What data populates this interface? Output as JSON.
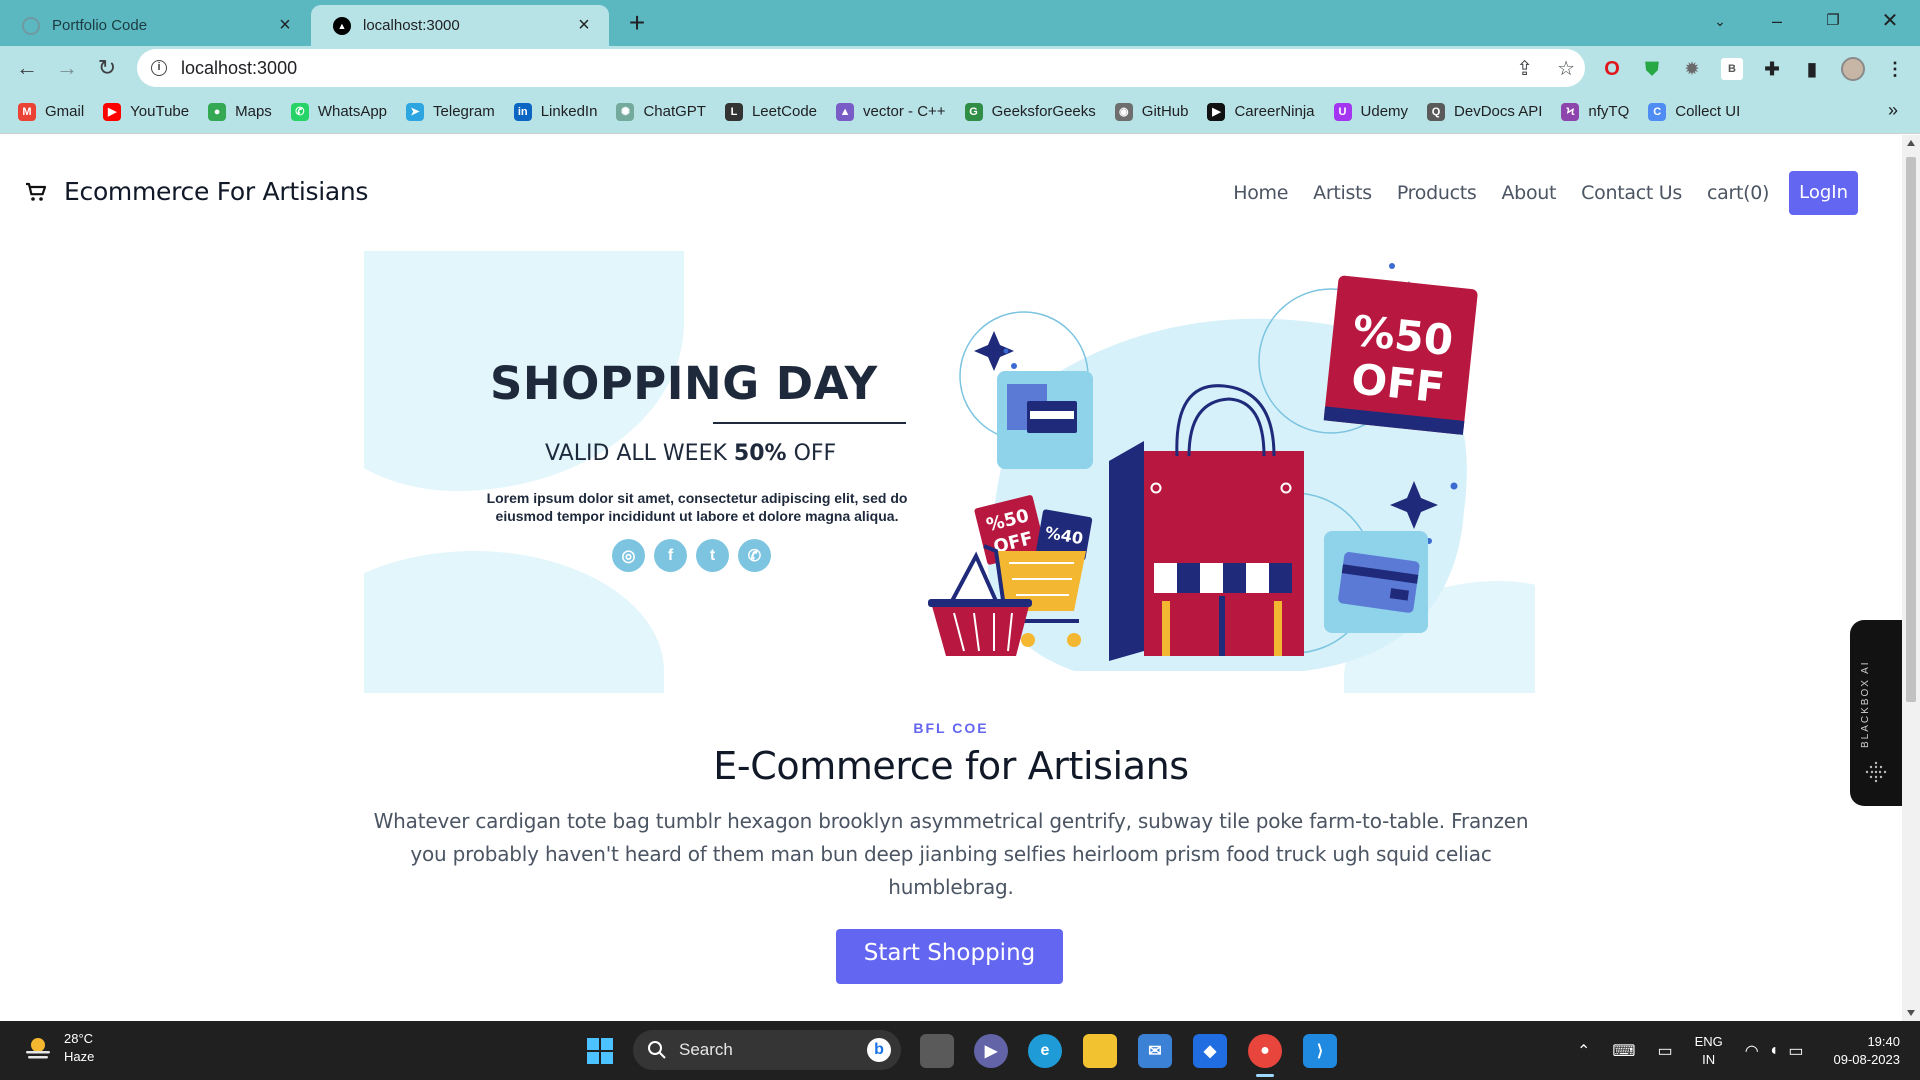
{
  "browser": {
    "tabs": [
      {
        "title": "Portfolio Code",
        "active": false
      },
      {
        "title": "localhost:3000",
        "active": true
      }
    ],
    "url": "localhost:3000",
    "bookmarks": [
      {
        "label": "Gmail",
        "icon": "gmail-icon",
        "color": "#ea4335"
      },
      {
        "label": "YouTube",
        "icon": "youtube-icon",
        "color": "#ff0000"
      },
      {
        "label": "Maps",
        "icon": "maps-icon",
        "color": "#34a853"
      },
      {
        "label": "WhatsApp",
        "icon": "whatsapp-icon",
        "color": "#25d366"
      },
      {
        "label": "Telegram",
        "icon": "telegram-icon",
        "color": "#2ca5e0"
      },
      {
        "label": "LinkedIn",
        "icon": "linkedin-icon",
        "color": "#0a66c2"
      },
      {
        "label": "ChatGPT",
        "icon": "chatgpt-icon",
        "color": "#74aa9c"
      },
      {
        "label": "LeetCode",
        "icon": "leetcode-icon",
        "color": "#333333"
      },
      {
        "label": "vector - C++",
        "icon": "cplusplus-icon",
        "color": "#7a5cc7"
      },
      {
        "label": "GeeksforGeeks",
        "icon": "geeksforgeeks-icon",
        "color": "#2f8d46"
      },
      {
        "label": "GitHub",
        "icon": "github-icon",
        "color": "#6e6e6e"
      },
      {
        "label": "CareerNinja",
        "icon": "careerninja-icon",
        "color": "#111111"
      },
      {
        "label": "Udemy",
        "icon": "udemy-icon",
        "color": "#a435f0"
      },
      {
        "label": "DevDocs API",
        "icon": "devdocs-icon",
        "color": "#5a5a5a"
      },
      {
        "label": "nfyTQ",
        "icon": "nfytq-icon",
        "color": "#8e44ad"
      },
      {
        "label": "Collect UI",
        "icon": "collectui-icon",
        "color": "#4f8df5"
      }
    ],
    "more_bookmarks": "»"
  },
  "site": {
    "brand": "Ecommerce For Artisians",
    "nav": [
      "Home",
      "Artists",
      "Products",
      "About",
      "Contact Us",
      "cart(0)"
    ],
    "login": "LogIn",
    "banner": {
      "title": "SHOPPING DAY",
      "valid_prefix": "VALID ALL WEEK ",
      "valid_bold": "50%",
      "valid_suffix": " OFF",
      "body": "Lorem ipsum dolor sit amet, consectetur adipiscing elit, sed do eiusmod tempor incididunt ut labore et dolore magna aliqua.",
      "socials": [
        "instagram-icon",
        "facebook-icon",
        "twitter-icon",
        "whatsapp-icon"
      ],
      "big_tag_line1": "%50",
      "big_tag_line2": "OFF",
      "small_tag1_line1": "%50",
      "small_tag1_line2": "OFF",
      "small_tag2": "%40"
    },
    "intro": {
      "eyebrow": "BFL COE",
      "title": "E-Commerce for Artisians",
      "body": "Whatever cardigan tote bag tumblr hexagon brooklyn asymmetrical gentrify, subway tile poke farm-to-table. Franzen you probably haven't heard of them man bun deep jianbing selfies heirloom prism food truck ugh squid celiac humblebrag.",
      "cta": "Start Shopping"
    },
    "widget_label": "BLACKBOX AI"
  },
  "taskbar": {
    "temperature": "28°C",
    "weather": "Haze",
    "search_placeholder": "Search",
    "language": "ENG",
    "region": "IN",
    "time": "19:40",
    "date": "09-08-2023"
  },
  "colors": {
    "accent": "#6366f1",
    "tab_strip": "#5bb8c1",
    "toolbar": "#b8e3e6",
    "banner_crimson": "#b8183f",
    "banner_navy": "#1f2a7a",
    "banner_light": "#e3f6fb"
  }
}
